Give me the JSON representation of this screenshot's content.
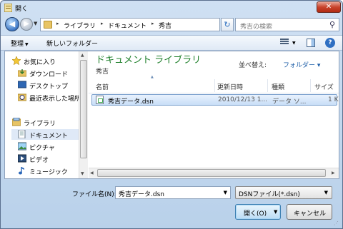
{
  "window": {
    "title": "開く",
    "close_label": "✕"
  },
  "address": {
    "crumbs": [
      "ライブラリ",
      "ドキュメント",
      "秀吉"
    ],
    "separator": "▸"
  },
  "search": {
    "placeholder": "秀吉の検索"
  },
  "toolbar": {
    "organize": "整理",
    "new_folder": "新しいフォルダー"
  },
  "sidebar": {
    "items": [
      {
        "label": "お気に入り",
        "icon": "star-icon"
      },
      {
        "label": "ダウンロード",
        "icon": "download-folder-icon"
      },
      {
        "label": "デスクトップ",
        "icon": "desktop-icon"
      },
      {
        "label": "最近表示した場所",
        "icon": "recent-places-icon"
      },
      {
        "label": "ライブラリ",
        "icon": "library-icon"
      },
      {
        "label": "ドキュメント",
        "icon": "documents-icon",
        "selected": true
      },
      {
        "label": "ピクチャ",
        "icon": "pictures-icon"
      },
      {
        "label": "ビデオ",
        "icon": "video-icon"
      },
      {
        "label": "ミュージック",
        "icon": "music-icon"
      }
    ]
  },
  "library": {
    "title": "ドキュメント ライブラリ",
    "subtitle": "秀吉",
    "arrange_label": "並べ替え:",
    "arrange_value": "フォルダー ▾"
  },
  "columns": [
    "名前",
    "更新日時",
    "種類",
    "サイズ"
  ],
  "files": [
    {
      "name": "秀吉データ.dsn",
      "modified": "2010/12/13 1...",
      "type": "データ ソ...",
      "size": "1 K"
    }
  ],
  "footer": {
    "filename_label": "ファイル名(N):",
    "filename_value": "秀吉データ.dsn",
    "filter_value": "DSNファイル(*.dsn)",
    "open_label": "開く(O)",
    "cancel_label": "キャンセル"
  },
  "colors": {
    "library_title": "#1e7f2a",
    "selection": "#c8def7",
    "link": "#1f5fa8"
  }
}
